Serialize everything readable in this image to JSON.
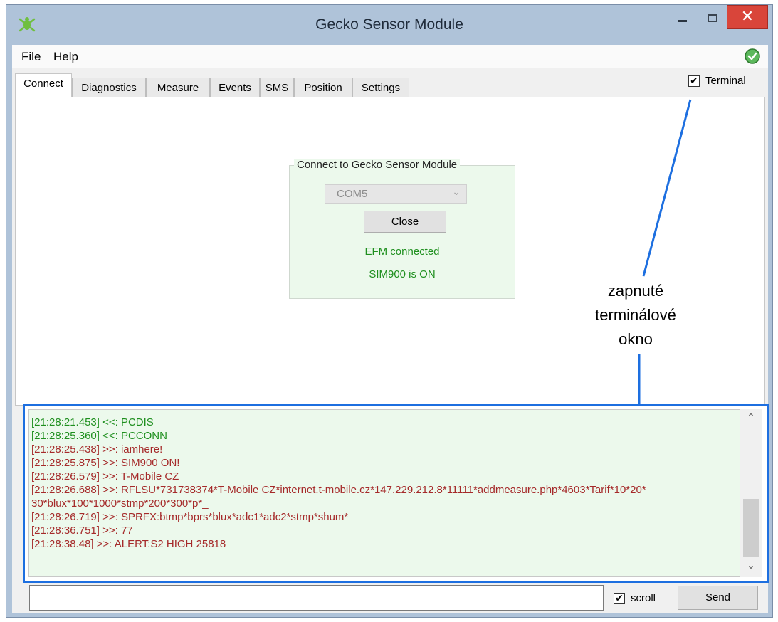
{
  "window": {
    "title": "Gecko Sensor Module",
    "close_glyph": "✕",
    "app_icon": "gecko-logo-icon",
    "status_icon": "connected-check-icon"
  },
  "menu": {
    "items": [
      {
        "label": "File"
      },
      {
        "label": "Help"
      }
    ]
  },
  "tabs": [
    {
      "label": "Connect",
      "active": true
    },
    {
      "label": "Diagnostics"
    },
    {
      "label": "Measure"
    },
    {
      "label": "Events"
    },
    {
      "label": "SMS"
    },
    {
      "label": "Position"
    },
    {
      "label": "Settings"
    }
  ],
  "terminal_toggle": {
    "label": "Terminal",
    "checked": true,
    "check_glyph": "✔"
  },
  "connect_panel": {
    "legend": "Connect to Gecko Sensor Module",
    "port": "COM5",
    "dropdown_glyph": "⌄",
    "close_label": "Close",
    "status_efm": "EFM connected",
    "status_sim": "SIM900 is ON",
    "status_color": "#1e8f1e"
  },
  "annotation": {
    "lines": [
      "zapnuté",
      "terminálové",
      "okno"
    ],
    "color": "#1d6fe0"
  },
  "terminal": {
    "log": [
      {
        "text": "[21:28:21.453] <<: PCDIS",
        "kind": "green"
      },
      {
        "text": "[21:28:25.360] <<:  PCCONN",
        "kind": "green"
      },
      {
        "text": "[21:28:25.438] >>: iamhere!",
        "kind": "red"
      },
      {
        "text": "[21:28:25.875] >>: SIM900 ON!",
        "kind": "red"
      },
      {
        "text": "[21:28:26.579] >>: T-Mobile CZ",
        "kind": "red"
      },
      {
        "text": "[21:28:26.688] >>: RFLSU*731738374*T-Mobile CZ*internet.t-mobile.cz*147.229.212.8*11111*addmeasure.php*4603*Tarif*10*20*",
        "kind": "red"
      },
      {
        "text": "30*blux*100*1000*stmp*200*300*p*_",
        "kind": "red"
      },
      {
        "text": "[21:28:26.719] >>: SPRFX:btmp*bprs*blux*adc1*adc2*stmp*shum*",
        "kind": "red"
      },
      {
        "text": "[21:28:36.751] >>: 77",
        "kind": "red"
      },
      {
        "text": "[21:28:38.48] >>:   ALERT:S2 HIGH 25818",
        "kind": "red"
      }
    ],
    "scroll_up_glyph": "⌃",
    "scroll_down_glyph": "⌄"
  },
  "bottom": {
    "command_value": "",
    "scroll_label": "scroll",
    "scroll_checked": true,
    "check_glyph": "✔",
    "send_label": "Send"
  }
}
